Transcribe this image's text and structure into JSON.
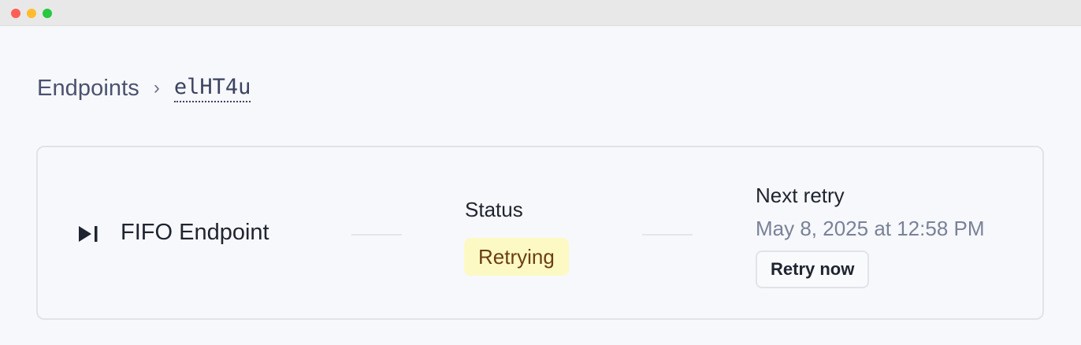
{
  "window": {
    "controls": [
      "close",
      "minimize",
      "maximize"
    ]
  },
  "breadcrumb": {
    "root": "Endpoints",
    "separator": "›",
    "current": "elHT4u"
  },
  "endpoint": {
    "icon": "skip-forward-icon",
    "name": "FIFO Endpoint"
  },
  "status": {
    "label": "Status",
    "value": "Retrying",
    "badge_color": "#fdf9c4",
    "text_color": "#6b3f12"
  },
  "next_retry": {
    "label": "Next retry",
    "time": "May 8, 2025 at 12:58 PM",
    "button_label": "Retry now"
  }
}
